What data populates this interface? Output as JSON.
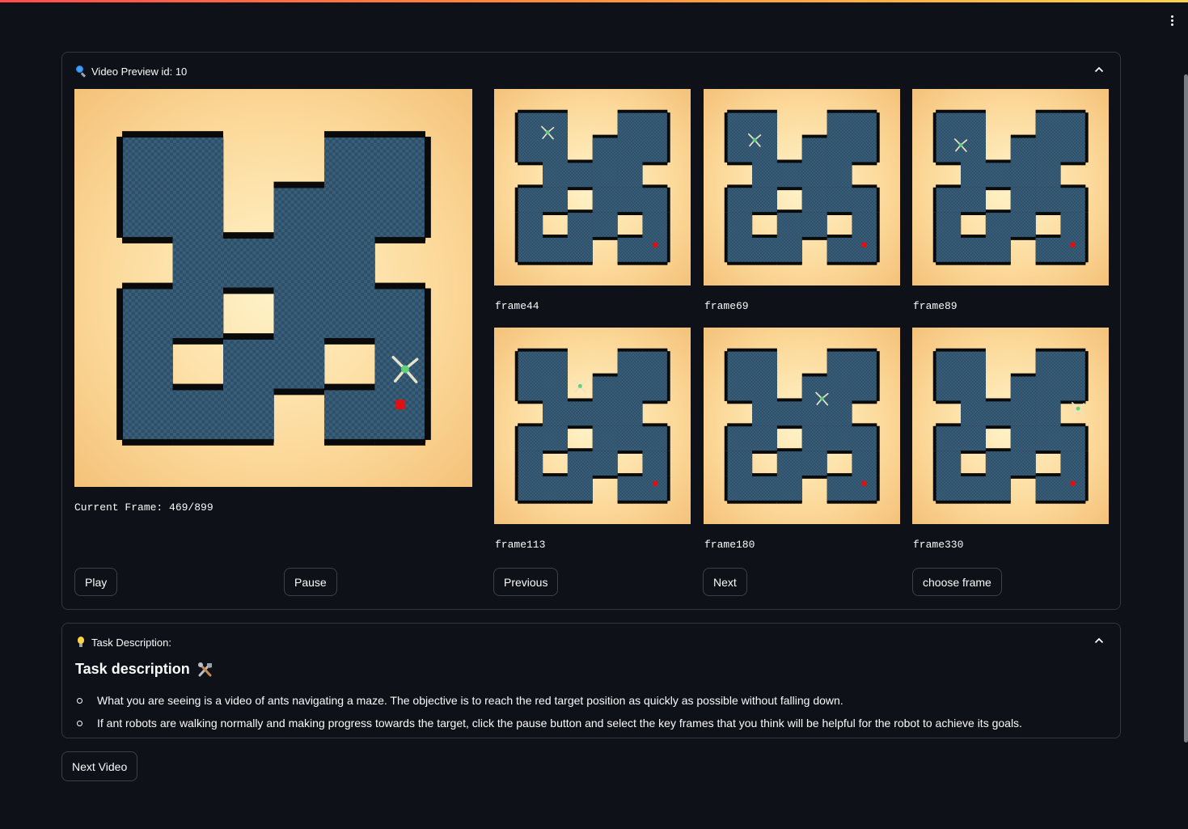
{
  "preview": {
    "title": "Video Preview id: 10",
    "current_frame": "Current Frame: 469/899",
    "progress": {
      "current": 469,
      "total": 899
    },
    "main_ant": {
      "col": 5.6,
      "row": 4.6
    },
    "thumbnails": [
      {
        "label": "frame44",
        "ant": {
          "col": 1.2,
          "row": 0.8
        }
      },
      {
        "label": "frame69",
        "ant": {
          "col": 1.1,
          "row": 1.1
        }
      },
      {
        "label": "frame89",
        "ant": {
          "col": 1.0,
          "row": 1.3
        }
      },
      {
        "label": "frame113",
        "ant": {
          "col": 2.5,
          "row": 1.4
        }
      },
      {
        "label": "frame180",
        "ant": {
          "col": 3.8,
          "row": 1.9
        }
      },
      {
        "label": "frame330",
        "ant": {
          "col": 5.7,
          "row": 2.3
        }
      }
    ],
    "buttons": {
      "play": "Play",
      "pause": "Pause",
      "previous": "Previous",
      "next": "Next",
      "choose": "choose frame"
    }
  },
  "task": {
    "header": "Task Description:",
    "title": "Task description",
    "items": [
      "What you are seeing is a video of ants navigating a maze. The objective is to reach the red target position as quickly as possible without falling down.",
      "If ant robots are walking normally and making progress towards the target, click the pause button and select the key frames that you think will be helpful for the robot to achieve its goals."
    ]
  },
  "next_video_label": "Next Video",
  "icons": {
    "preview": "magnifier-icon",
    "task": "light-bulb-icon",
    "title": "tools-icon",
    "collapse": "chevron-up-icon",
    "menu": "kebab-menu-icon"
  },
  "colors": {
    "background": "#0e1117",
    "border": "#33363e",
    "maze_floor": "#3a5f7a",
    "maze_sand": "#fcd99a",
    "target": "#e01010"
  },
  "maze": {
    "grid": [
      "......",
      ".##.##",
      ".##.##",
      "##..##",
      "..#.##",
      "##..##",
      "#..#..",
      "##..#."
    ],
    "cols": 6,
    "rows": 6,
    "layout": [
      "##..##",
      "##.###",
      ".####.",
      "##.###",
      "#.##.#",
      "###.##"
    ],
    "target": {
      "col": 5.5,
      "row": 5.3
    }
  }
}
